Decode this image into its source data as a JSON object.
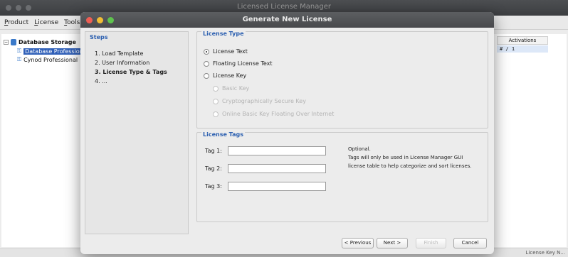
{
  "app": {
    "title": "Licensed License Manager",
    "menu": [
      "Product",
      "License",
      "Tools"
    ],
    "tree": {
      "root": "Database Storage",
      "children": [
        "Database Professional",
        "Cynod Professional"
      ]
    },
    "table": {
      "header": "Activations",
      "cell": "# / 1"
    },
    "status": "License Key N..."
  },
  "dialog": {
    "title": "Generate New License",
    "steps": {
      "heading": "Steps",
      "items": [
        "1. Load Template",
        "2. User Information",
        "3. License Type & Tags",
        "4. ..."
      ],
      "current_index": 2
    },
    "license_type": {
      "heading": "License Type",
      "options": [
        {
          "label": "License Text",
          "checked": true
        },
        {
          "label": "Floating License Text",
          "checked": false
        },
        {
          "label": "License Key",
          "checked": false
        }
      ],
      "sub_options": [
        "Basic Key",
        "Cryptographically Secure Key",
        "Online Basic Key Floating Over Internet"
      ]
    },
    "license_tags": {
      "heading": "License Tags",
      "tags": [
        {
          "label": "Tag 1:",
          "value": ""
        },
        {
          "label": "Tag 2:",
          "value": ""
        },
        {
          "label": "Tag 3:",
          "value": ""
        }
      ],
      "note_title": "Optional.",
      "note_line1": "Tags will only be used in License Manager GUI",
      "note_line2": "license table to help categorize and sort licenses."
    },
    "buttons": {
      "previous": "< Previous",
      "next": "Next >",
      "finish": "Finish",
      "cancel": "Cancel"
    }
  },
  "colors": {
    "accent": "#2b5fb0",
    "close": "#ee5e54",
    "minimize": "#f1bd34",
    "zoom": "#5ec34d"
  }
}
